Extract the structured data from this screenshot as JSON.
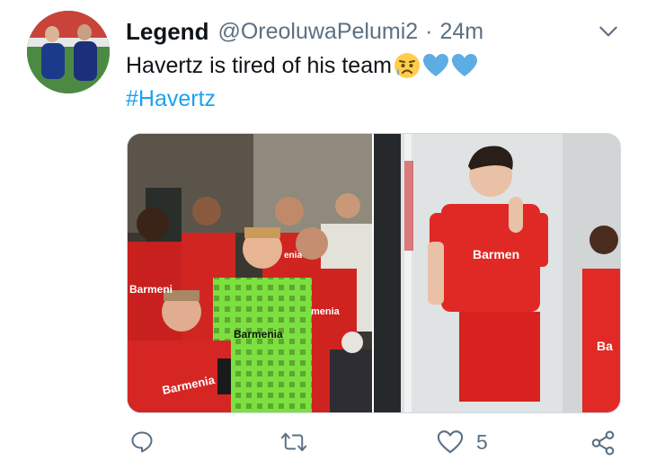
{
  "tweet": {
    "display_name": "Legend",
    "handle": "@OreoluwaPelumi2",
    "separator": "·",
    "time": "24m",
    "text": "Havertz is tired of his team",
    "hashtag": "#Havertz"
  },
  "media": {
    "left_sponsor_1": "Barmenia",
    "left_sponsor_2": "Barmeni",
    "left_sponsor_3": "Barmenia",
    "left_sponsor_4": "menia",
    "left_sponsor_5": "enia",
    "right_sponsor_1": "Barmen",
    "right_sponsor_2": "Ba"
  },
  "actions": {
    "like_count": "5"
  },
  "colors": {
    "accent": "#1da1f2",
    "muted": "#5b7083",
    "heart_emoji": "#5dade2"
  },
  "icons": {
    "reply": "reply-icon",
    "retweet": "retweet-icon",
    "like": "heart-icon",
    "share": "share-icon",
    "menu": "chevron-down-icon"
  }
}
